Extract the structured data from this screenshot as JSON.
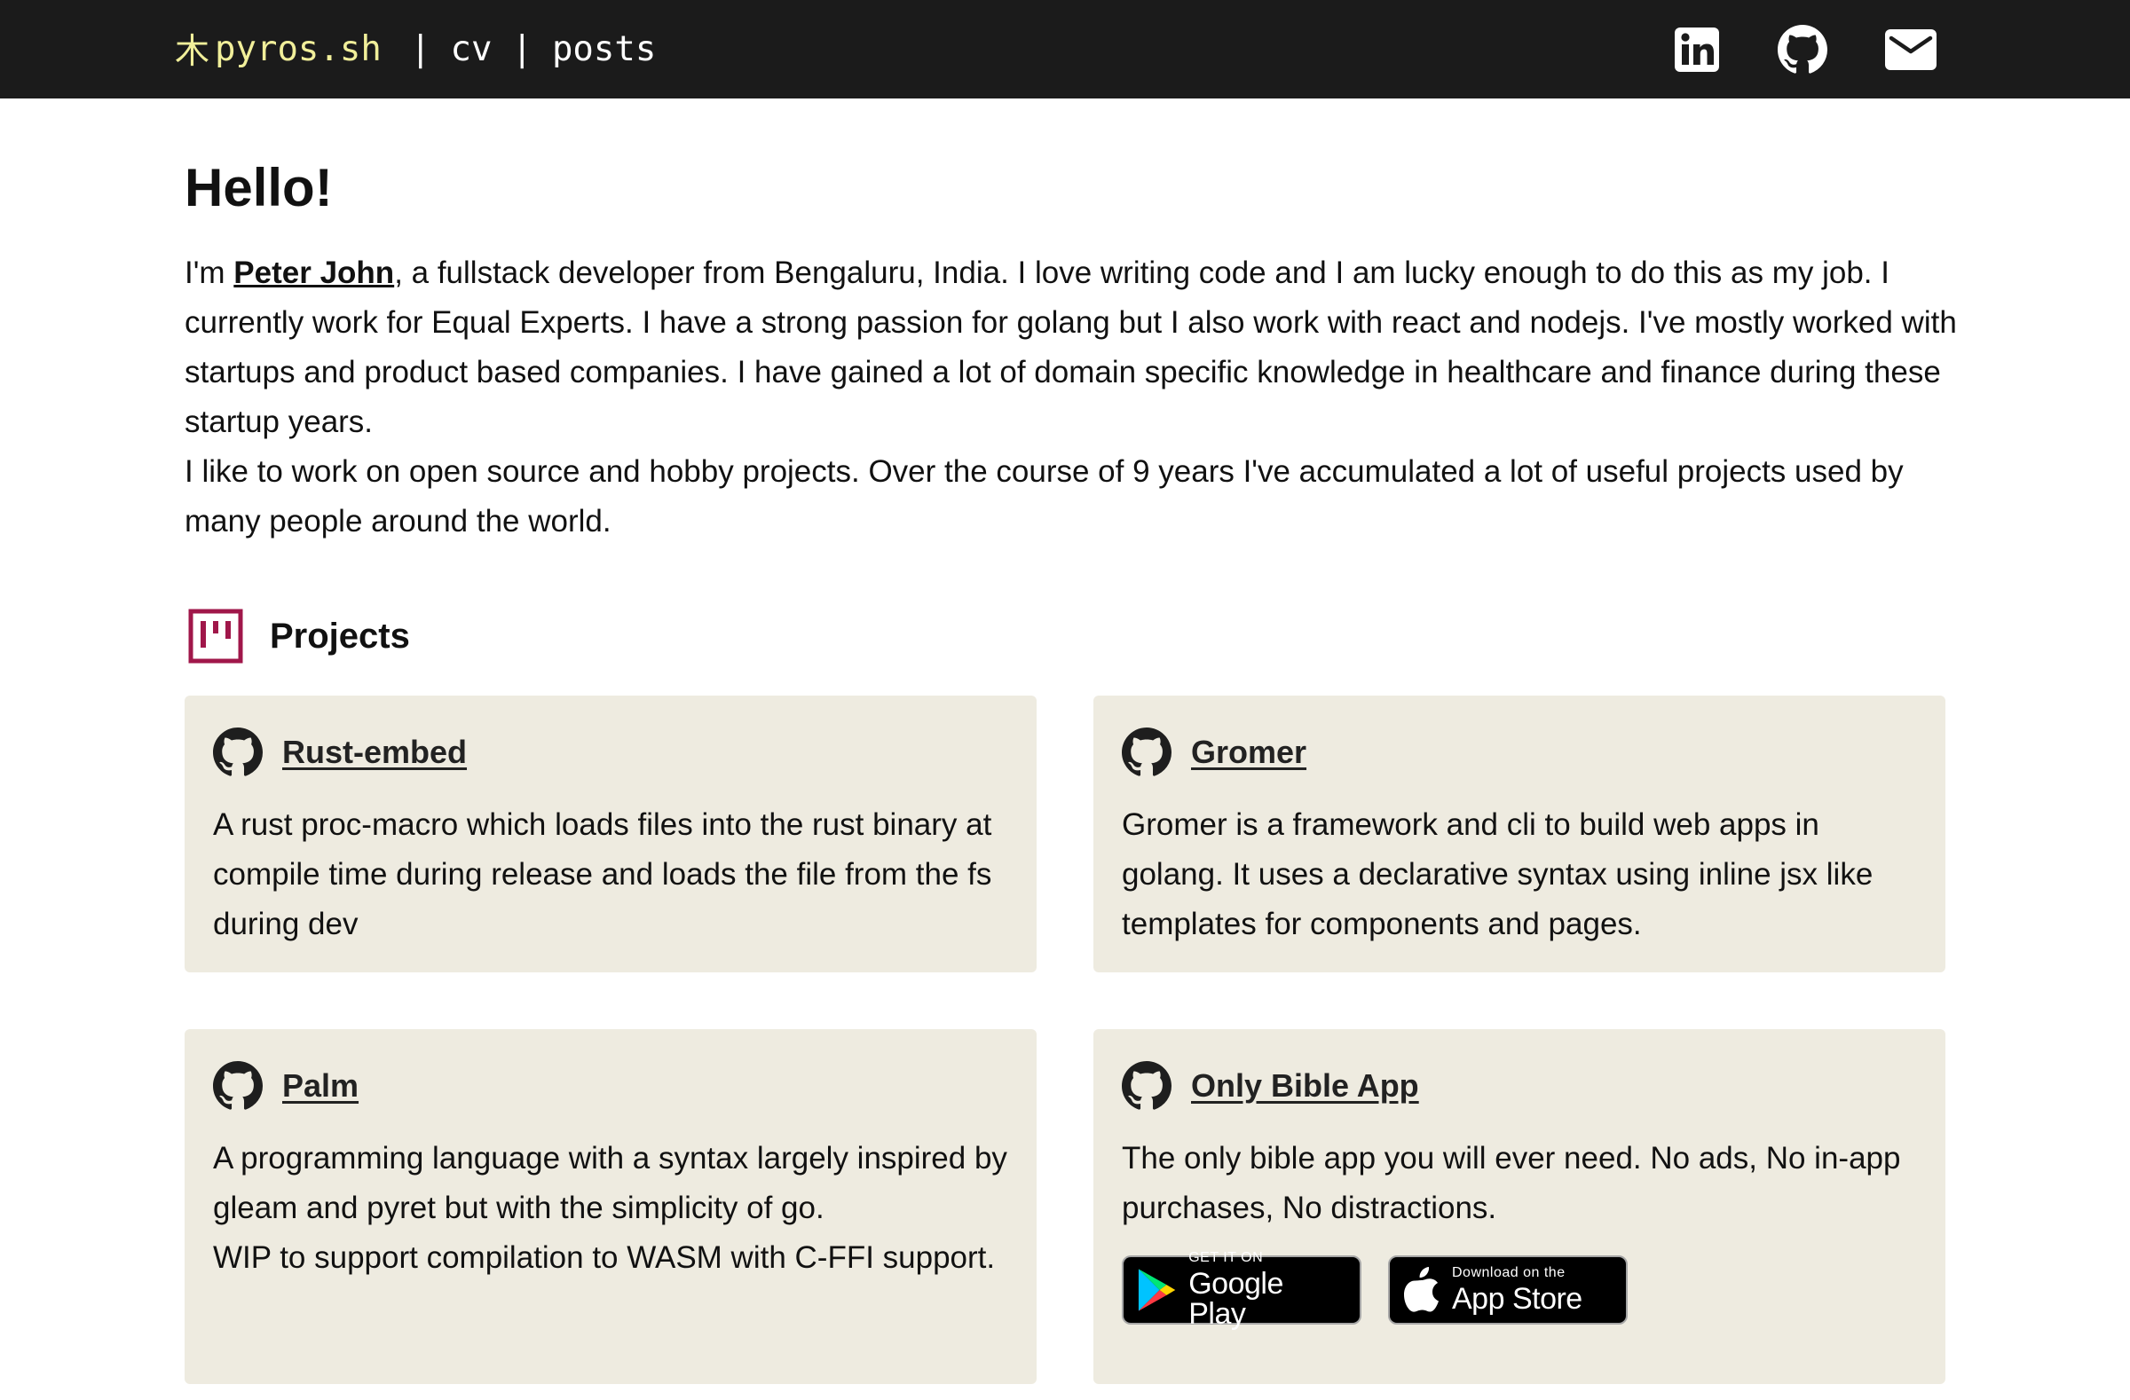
{
  "header": {
    "brand_kanji": "木",
    "brand_text": "pyros.sh",
    "separator": "|",
    "nav": [
      {
        "label": "cv"
      },
      {
        "label": "posts"
      }
    ],
    "social_icons": [
      "linkedin-icon",
      "github-icon",
      "mail-icon"
    ]
  },
  "intro": {
    "heading": "Hello!",
    "line1_prefix": "I'm ",
    "name_link": "Peter John",
    "line1_rest": ", a fullstack developer from Bengaluru, India. I love writing code and I am lucky enough to do this as my job. I currently work for Equal Experts. I have a strong passion for golang but I also work with react and nodejs. I've mostly worked with startups and product based companies. I have gained a lot of domain specific knowledge in healthcare and finance during these startup years.",
    "paragraph2": "I like to work on open source and hobby projects. Over the course of 9 years I've accumulated a lot of useful projects used by many people around the world."
  },
  "projects": {
    "heading": "Projects",
    "icon": "kanban-board-icon",
    "items": [
      {
        "title": "Rust-embed",
        "icon": "github-icon",
        "description": [
          "A rust proc-macro which loads files into the rust binary at compile time during release and loads the file from the fs during dev"
        ]
      },
      {
        "title": "Gromer",
        "icon": "github-icon",
        "description": [
          "Gromer is a framework and cli to build web apps in golang. It uses a declarative syntax using inline jsx like templates for components and pages."
        ]
      },
      {
        "title": "Palm",
        "icon": "github-icon",
        "description": [
          "A programming language with a syntax largely inspired by gleam and pyret but with the simplicity of go.",
          "WIP to support compilation to WASM with C-FFI support."
        ]
      },
      {
        "title": "Only Bible App",
        "icon": "github-icon",
        "description": [
          "The only bible app you will ever need. No ads, No in-app purchases, No distractions."
        ],
        "stores": [
          {
            "small": "GET IT ON",
            "big": "Google Play",
            "icon": "google-play-icon"
          },
          {
            "small": "Download on the",
            "big": "App Store",
            "icon": "apple-icon"
          }
        ]
      }
    ]
  },
  "colors": {
    "topbar_bg": "#1b1b1b",
    "brand_color": "#f1ef9a",
    "card_bg": "#eeebe0",
    "projects_icon": "#a0174a"
  }
}
